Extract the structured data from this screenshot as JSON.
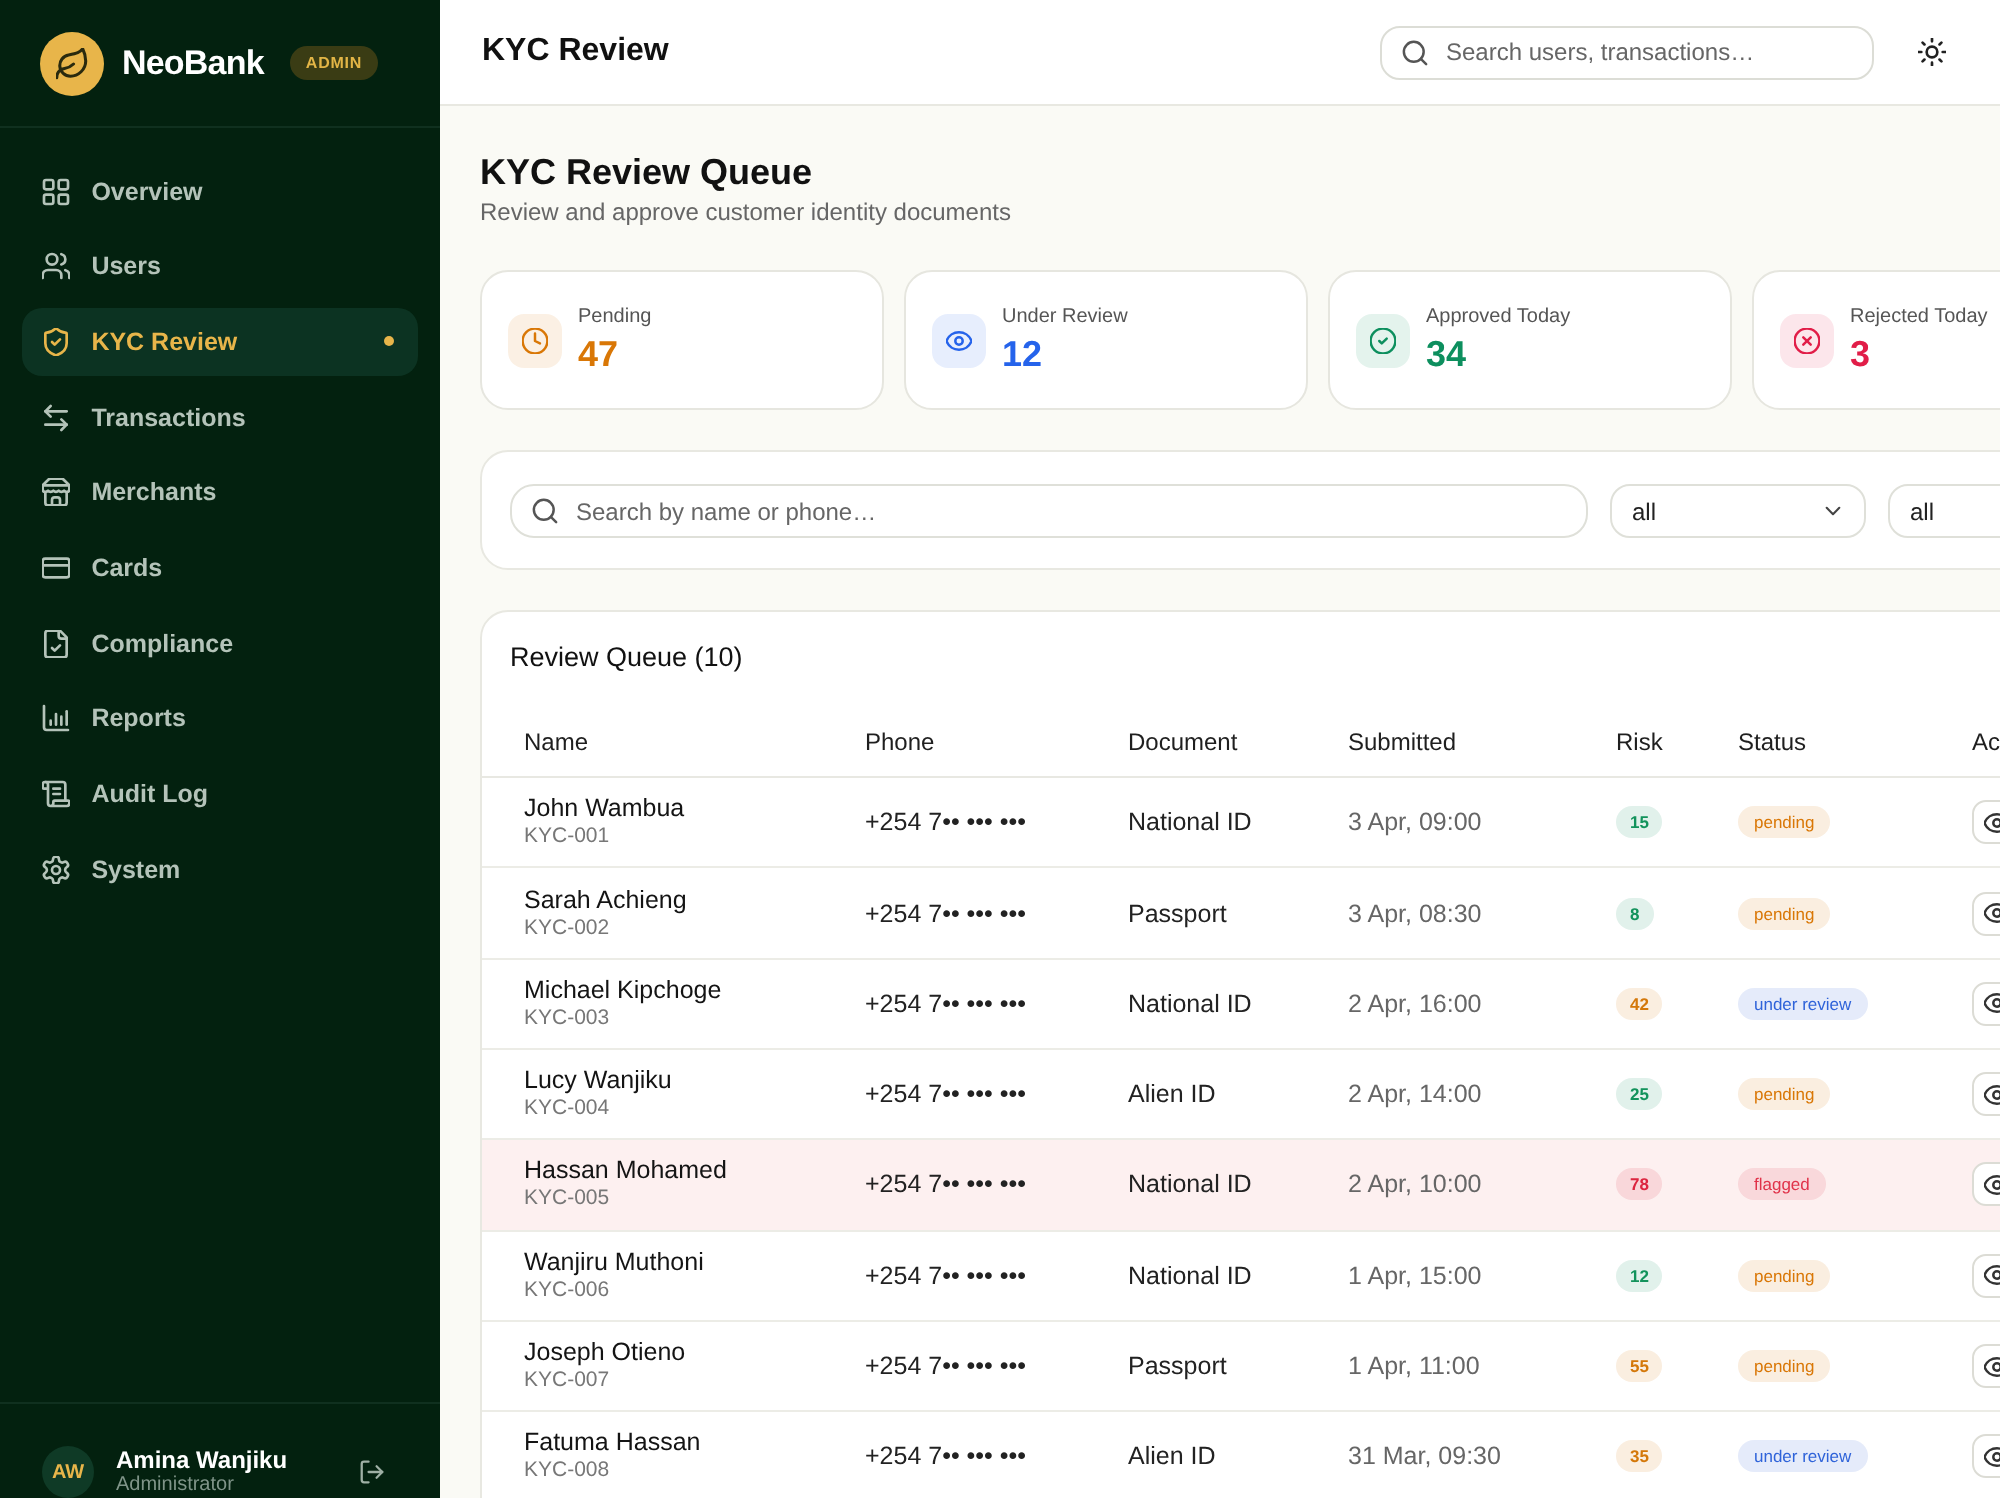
{
  "sidebar": {
    "brand": "NeoBank",
    "badge": "ADMIN",
    "nav": [
      {
        "label": "Overview",
        "selected": false
      },
      {
        "label": "Users",
        "selected": false
      },
      {
        "label": "KYC Review",
        "selected": true
      },
      {
        "label": "Transactions",
        "selected": false
      },
      {
        "label": "Merchants",
        "selected": false
      },
      {
        "label": "Cards",
        "selected": false
      },
      {
        "label": "Compliance",
        "selected": false
      },
      {
        "label": "Reports",
        "selected": false
      },
      {
        "label": "Audit Log",
        "selected": false
      },
      {
        "label": "System",
        "selected": false
      }
    ],
    "user": {
      "initials": "AW",
      "name": "Amina Wanjiku",
      "role": "Administrator"
    }
  },
  "header": {
    "title": "KYC Review",
    "search": {
      "placeholder": "Search users, transactions…"
    }
  },
  "page": {
    "title": "KYC Review Queue",
    "subtitle": "Review and approve customer identity documents"
  },
  "stats": [
    {
      "label": "Pending",
      "value": "47",
      "color": "#d97706"
    },
    {
      "label": "Under Review",
      "value": "12",
      "color": "#2563eb"
    },
    {
      "label": "Approved Today",
      "value": "34",
      "color": "#0d8f5e"
    },
    {
      "label": "Rejected Today",
      "value": "3",
      "color": "#e11d48"
    }
  ],
  "filters": {
    "search": {
      "placeholder": "Search by name or phone…"
    },
    "selects": [
      {
        "value": "all"
      },
      {
        "value": "all"
      }
    ]
  },
  "queue": {
    "title": "Review Queue (10)",
    "columns": [
      "Name",
      "Phone",
      "Document",
      "Submitted",
      "Risk",
      "Status",
      "Ac"
    ],
    "rows": [
      {
        "name": "John Wambua",
        "id": "KYC-001",
        "phone": "+254 7•• ••• •••",
        "document": "National ID",
        "submitted": "3 Apr, 09:00",
        "risk": {
          "value": "15",
          "color": "#13935c"
        },
        "status": {
          "label": "pending",
          "color": "#d97706"
        },
        "highlighted": false
      },
      {
        "name": "Sarah Achieng",
        "id": "KYC-002",
        "phone": "+254 7•• ••• •••",
        "document": "Passport",
        "submitted": "3 Apr, 08:30",
        "risk": {
          "value": "8",
          "color": "#13935c"
        },
        "status": {
          "label": "pending",
          "color": "#d97706"
        },
        "highlighted": false
      },
      {
        "name": "Michael Kipchoge",
        "id": "KYC-003",
        "phone": "+254 7•• ••• •••",
        "document": "National ID",
        "submitted": "2 Apr, 16:00",
        "risk": {
          "value": "42",
          "color": "#d4780a"
        },
        "status": {
          "label": "under review",
          "color": "#2f63d9"
        },
        "highlighted": false
      },
      {
        "name": "Lucy Wanjiku",
        "id": "KYC-004",
        "phone": "+254 7•• ••• •••",
        "document": "Alien ID",
        "submitted": "2 Apr, 14:00",
        "risk": {
          "value": "25",
          "color": "#13935c"
        },
        "status": {
          "label": "pending",
          "color": "#d97706"
        },
        "highlighted": false
      },
      {
        "name": "Hassan Mohamed",
        "id": "KYC-005",
        "phone": "+254 7•• ••• •••",
        "document": "National ID",
        "submitted": "2 Apr, 10:00",
        "risk": {
          "value": "78",
          "color": "#dc2640"
        },
        "status": {
          "label": "flagged",
          "color": "#e0334a"
        },
        "highlighted": true
      },
      {
        "name": "Wanjiru Muthoni",
        "id": "KYC-006",
        "phone": "+254 7•• ••• •••",
        "document": "National ID",
        "submitted": "1 Apr, 15:00",
        "risk": {
          "value": "12",
          "color": "#13935c"
        },
        "status": {
          "label": "pending",
          "color": "#d97706"
        },
        "highlighted": false
      },
      {
        "name": "Joseph Otieno",
        "id": "KYC-007",
        "phone": "+254 7•• ••• •••",
        "document": "Passport",
        "submitted": "1 Apr, 11:00",
        "risk": {
          "value": "55",
          "color": "#d4780a"
        },
        "status": {
          "label": "pending",
          "color": "#d97706"
        },
        "highlighted": false
      },
      {
        "name": "Fatuma Hassan",
        "id": "KYC-008",
        "phone": "+254 7•• ••• •••",
        "document": "Alien ID",
        "submitted": "31 Mar, 09:30",
        "risk": {
          "value": "35",
          "color": "#d4780a"
        },
        "status": {
          "label": "under review",
          "color": "#2f63d9"
        },
        "highlighted": false
      }
    ]
  }
}
